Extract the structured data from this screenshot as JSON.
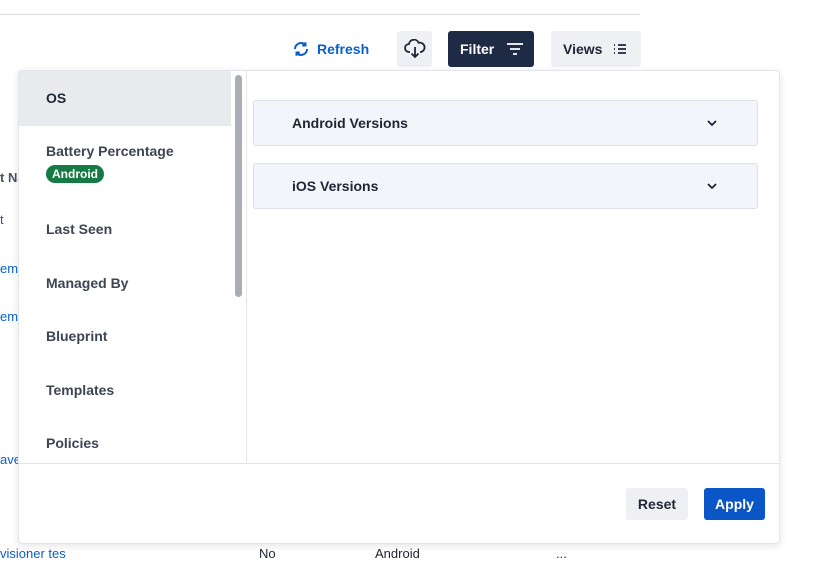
{
  "toolbar": {
    "refresh_label": "Refresh",
    "filter_label": "Filter",
    "views_label": "Views",
    "icons": {
      "refresh": "refresh-icon",
      "download": "cloud-download-icon",
      "filter": "filter-lines-icon",
      "views": "list-icon"
    }
  },
  "background_table": {
    "header_fragment": "t Na",
    "link_fragments": [
      "t",
      "em",
      "em",
      "ave"
    ],
    "bottom_row": [
      "visioner tes",
      "No",
      "Android",
      "..."
    ]
  },
  "filter_panel": {
    "categories": [
      {
        "label": "OS",
        "active": true
      },
      {
        "label": "Battery Percentage",
        "badge": "Android"
      },
      {
        "label": "Last Seen"
      },
      {
        "label": "Managed By"
      },
      {
        "label": "Blueprint"
      },
      {
        "label": "Templates"
      },
      {
        "label": "Policies"
      }
    ],
    "sections": [
      {
        "label": "Android Versions",
        "icon": "chevron-down-icon"
      },
      {
        "label": "iOS Versions",
        "icon": "chevron-down-icon"
      }
    ],
    "reset_label": "Reset",
    "apply_label": "Apply"
  },
  "colors": {
    "primary": "#0b56c6",
    "filter_button_bg": "#1f2a44",
    "badge_green": "#167a45",
    "link_blue": "#0b5fcb"
  }
}
